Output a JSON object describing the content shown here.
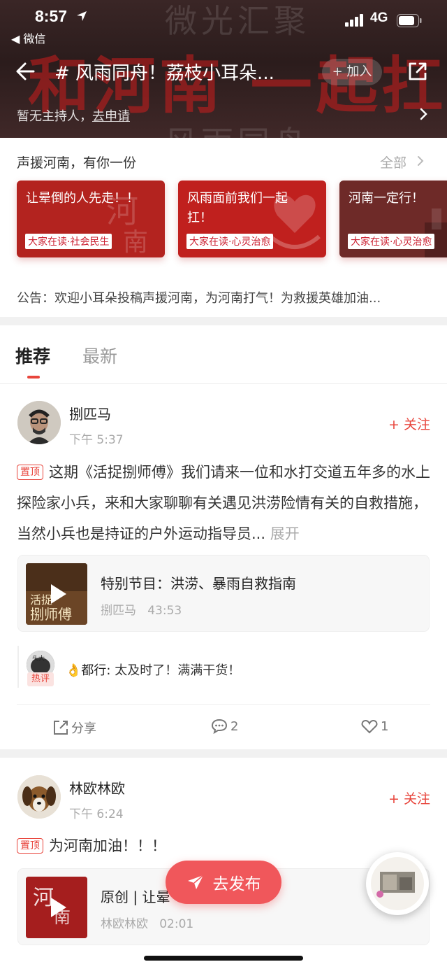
{
  "status": {
    "time": "8:57",
    "network": "4G",
    "back_app": "◀ 微信"
  },
  "header": {
    "bg_text_top": "微光汇聚",
    "bg_text_red": "和河南 一起扛",
    "bg_text_bottom": "风雨同舟",
    "topic_title": "# 风雨同舟！荔枝小耳朵...",
    "join_label": "+ 加入",
    "host_prefix": "暂无主持人，",
    "host_apply": "去申请"
  },
  "section": {
    "title": "声援河南，有你一份",
    "all_label": "全部",
    "cards": [
      {
        "title": "让晕倒的人先走！！",
        "tag": "大家在读·社会民生",
        "bg": "#b3231f"
      },
      {
        "title": "风雨面前我们一起扛！",
        "tag": "大家在读·心灵治愈",
        "bg": "#c0201e"
      },
      {
        "title": "河南一定行！",
        "tag": "大家在读·心灵治愈",
        "bg": "#6e2a28"
      }
    ],
    "notice": "公告：欢迎小耳朵投稿声援河南，为河南打气！为救援英雄加油..."
  },
  "tabs": {
    "recommend": "推荐",
    "latest": "最新"
  },
  "posts": [
    {
      "user": "捌匹马",
      "time": "下午 5:37",
      "follow": "+ 关注",
      "pin": "置顶",
      "text": "这期《活捉捌师傅》我们请来一位和水打交道五年多的水上探险家小兵，来和大家聊聊有关遇见洪涝险情有关的自救措施，当然小兵也是持证的户外运动指导员...",
      "expand": "展开",
      "audio_title": "特别节目：洪涝、暴雨自救指南",
      "audio_author": "捌匹马",
      "audio_duration": "43:53",
      "hot_badge": "热评",
      "hot_avatar_text": "头大",
      "comment_emoji": "👌",
      "comment_user": "都行:",
      "comment_text": "太及时了！满满干货！",
      "share": "分享",
      "comments": "2",
      "likes": "1"
    },
    {
      "user": "林欧林欧",
      "time": "下午 6:24",
      "follow": "+ 关注",
      "pin": "置顶",
      "text": "为河南加油！！！",
      "audio_title": "原创 | 让晕",
      "audio_author": "林欧林欧",
      "audio_duration": "02:01"
    }
  ],
  "fab": {
    "label": "去发布"
  }
}
